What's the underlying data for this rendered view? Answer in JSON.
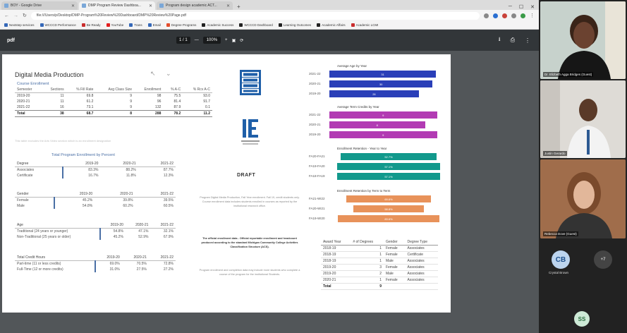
{
  "browser": {
    "tabs": [
      {
        "label": "BOY - Google Drive",
        "active": false
      },
      {
        "label": "DMP Program Review Dashboa...",
        "active": true
      },
      {
        "label": "Program design academic ACT...",
        "active": false
      }
    ],
    "url": "file:///Users/p/Desktop/DMP-Program%20Review%20Dashboard/DMP%20Review%20Page.pdf",
    "bookmarks": [
      "Nextstep services",
      "WCCCD Performance",
      "Be Ready",
      "YouTube",
      "Trans",
      "Email",
      "Degree Programs",
      "Academic Success",
      "WCCCD Dashboard",
      "Learning Outcomes",
      "Academic Affairs",
      "Academic LCMI"
    ]
  },
  "pdf": {
    "title": "pdf",
    "page": "1 / 1",
    "zoom": "100%"
  },
  "dashboard": {
    "title": "Digital Media Production",
    "enrollment": {
      "caption": "Course Enrollment",
      "headers": [
        "Semester",
        "Sections",
        "% Fill Rate",
        "Avg Class Size",
        "Enrollment",
        "% A-C",
        "% Rcv A-C"
      ],
      "rows": [
        [
          "2019-20",
          "11",
          "69.8",
          "9",
          "98",
          "75.5",
          "93.0"
        ],
        [
          "2020-21",
          "11",
          "61.2",
          "9",
          "96",
          "81.4",
          "91.7"
        ],
        [
          "2021-22",
          "16",
          "73.1",
          "9",
          "132",
          "87.9",
          "0.1"
        ]
      ],
      "total": [
        "Total",
        "38",
        "68.7",
        "8",
        "288",
        "78.2",
        "11.2"
      ],
      "footnote": "This table excludes the Arts Video section which is an enrollment designation"
    },
    "program_title": "Total Program Enrollment by Percent",
    "degree": {
      "headers": [
        "Degree",
        "2019-20",
        "2020-21",
        "2021-22"
      ],
      "rows": [
        [
          "Associates",
          "83.3%",
          "88.2%",
          "87.7%"
        ],
        [
          "Certificate",
          "16.7%",
          "11.8%",
          "12.3%"
        ]
      ]
    },
    "gender": {
      "headers": [
        "Gender",
        "2019-20",
        "2020-21",
        "2021-22"
      ],
      "rows": [
        [
          "Female",
          "45.2%",
          "39.8%",
          "39.5%"
        ],
        [
          "Male",
          "54.8%",
          "60.2%",
          "60.5%"
        ]
      ]
    },
    "age": {
      "headers": [
        "Age",
        "2019-20",
        "2020-21",
        "2021-22"
      ],
      "rows": [
        [
          "Traditional (24 years or younger)",
          "54.8%",
          "47.1%",
          "32.1%"
        ],
        [
          "Non-Traditional (25 years or older)",
          "45.2%",
          "52.9%",
          "67.9%"
        ]
      ]
    },
    "credit": {
      "headers": [
        "Total Credit Hours",
        "2019-20",
        "2020-21",
        "2021-22"
      ],
      "rows": [
        [
          "Part-time (11 or less credits)",
          "69.0%",
          "70.5%",
          "72.8%"
        ],
        [
          "Full-Time (12 or more credits)",
          "31.0%",
          "27.5%",
          "27.2%"
        ]
      ]
    },
    "center": {
      "draft": "DRAFT",
      "note1": "Program Digital Media Production, Fall Year enrollment. Fall 19, credit students only. Course enrollment data includes students enrolled in courses as reported by the institutional research office.",
      "note2": "The official enrollment data - Official reportable enrollment and headcount produced according to the standard Michigan Community College Activities Classification Structure (ACS).",
      "note3": "Program enrollment and completion data may include more students who complete a course of the program for the institutional Students."
    },
    "age_chart": {
      "title": "Average Age by Year",
      "rows": [
        {
          "label": "2021-22",
          "value": 31
        },
        {
          "label": "2020-21",
          "value": 30
        },
        {
          "label": "2019-20",
          "value": 26
        }
      ],
      "color": "#2a3fb8"
    },
    "credits_chart": {
      "title": "Average Term Credits by Year",
      "rows": [
        {
          "label": "2021-22",
          "value": 9
        },
        {
          "label": "2020-21",
          "value": 8
        },
        {
          "label": "2019-20",
          "value": 9
        }
      ],
      "color": "#b23bb3"
    },
    "retention_year": {
      "title": "Enrollment Retention - Year to Year",
      "rows": [
        {
          "label": "FA20-FA21",
          "value": "52.7%"
        },
        {
          "label": "FA19-FA20",
          "value": "57.1%"
        },
        {
          "label": "FA18-FA19",
          "value": "57.1%"
        }
      ],
      "color": "#12998c"
    },
    "retention_term": {
      "title": "Enrollment Retention by Term to Term",
      "rows": [
        {
          "label": "FA21-WI22",
          "value": "69.6%"
        },
        {
          "label": "FA20-WI21",
          "value": "58.8%"
        },
        {
          "label": "FA19-WI20",
          "value": "83.6%"
        }
      ],
      "color": "#e8925a"
    },
    "awards": {
      "headers": [
        "Award Year",
        "# of Degrees",
        "Gender",
        "Degree Type"
      ],
      "rows": [
        [
          "2018-19",
          "1",
          "Female",
          "Associates"
        ],
        [
          "2018-19",
          "1",
          "Female",
          "Certificate"
        ],
        [
          "2018-19",
          "1",
          "Male",
          "Associates"
        ],
        [
          "2019-20",
          "3",
          "Female",
          "Associates"
        ],
        [
          "2019-20",
          "2",
          "Male",
          "Associates"
        ],
        [
          "2020-21",
          "1",
          "Female",
          "Associates"
        ]
      ],
      "total": [
        "Total",
        "9",
        "",
        ""
      ]
    }
  },
  "participants": [
    {
      "name": "Dr. Elizbeth Agga Bridges (Guest)"
    },
    {
      "name": "Justin Gerardo"
    },
    {
      "name": "Rebecca Dove (Guest)"
    },
    {
      "initials": "CB",
      "name": "Crystal Brown"
    },
    {
      "initials": "+7",
      "name": ""
    },
    {
      "initials": "SS",
      "name": ""
    }
  ]
}
